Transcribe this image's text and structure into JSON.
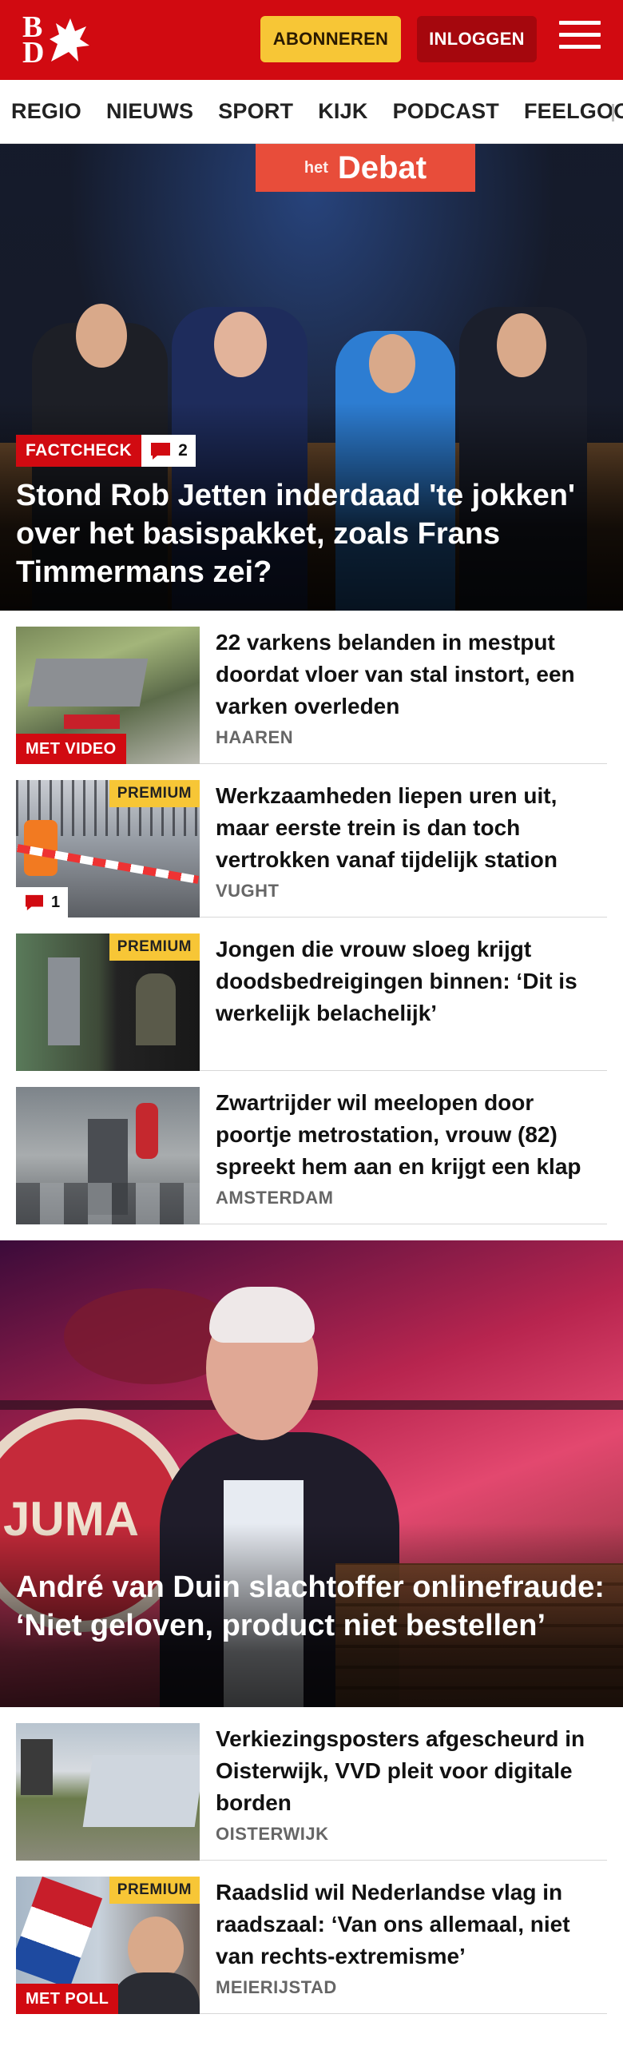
{
  "header": {
    "logo_line1": "B",
    "logo_line2": "D",
    "subscribe_label": "ABONNEREN",
    "login_label": "INLOGGEN",
    "brand_color": "#d10a11",
    "subscribe_color": "#f7c636"
  },
  "nav": {
    "items": [
      {
        "label": "REGIO"
      },
      {
        "label": "NIEUWS"
      },
      {
        "label": "SPORT"
      },
      {
        "label": "KIJK"
      },
      {
        "label": "PODCAST"
      },
      {
        "label": "FEELGOOD"
      }
    ]
  },
  "hero": {
    "sign_text": "Debat",
    "sign_small": "het",
    "tag": "FACTCHECK",
    "comments": "2",
    "title": "Stond Rob Jetten inderdaad 'te jokken' over het basispakket, zoals Frans Timmermans zei?"
  },
  "articles": [
    {
      "title": "22 varkens belanden in mestput doordat vloer van stal instort, een varken overleden",
      "location": "HAAREN",
      "badge": "MET VIDEO"
    },
    {
      "title": "Werkzaamheden liepen uren uit, maar eerste trein is dan toch vertrokken vanaf tijdelijk station",
      "location": "VUGHT",
      "premium": "PREMIUM",
      "comments": "1"
    },
    {
      "title": "Jongen die vrouw sloeg krijgt doodsbedreigingen binnen: ‘Dit is werkelijk belachelijk’",
      "premium": "PREMIUM"
    },
    {
      "title": "Zwartrijder wil meelopen door poortje metrostation, vrouw (82) spreekt hem aan en krijgt een klap",
      "location": "AMSTERDAM"
    }
  ],
  "hero2": {
    "circle_text": "JUMA",
    "title": "André van Duin slachtoffer onlinefraude: ‘Niet geloven, product niet bestellen’"
  },
  "articles2": [
    {
      "title": "Verkiezingsposters afgescheurd in Oisterwijk, VVD pleit voor digitale borden",
      "location": "OISTERWIJK"
    },
    {
      "title": "Raadslid wil Nederlandse vlag in raadszaal: ‘Van ons allemaal, niet van rechts-extremisme’",
      "location": "MEIERIJSTAD",
      "premium": "PREMIUM",
      "badge": "MET POLL"
    }
  ]
}
